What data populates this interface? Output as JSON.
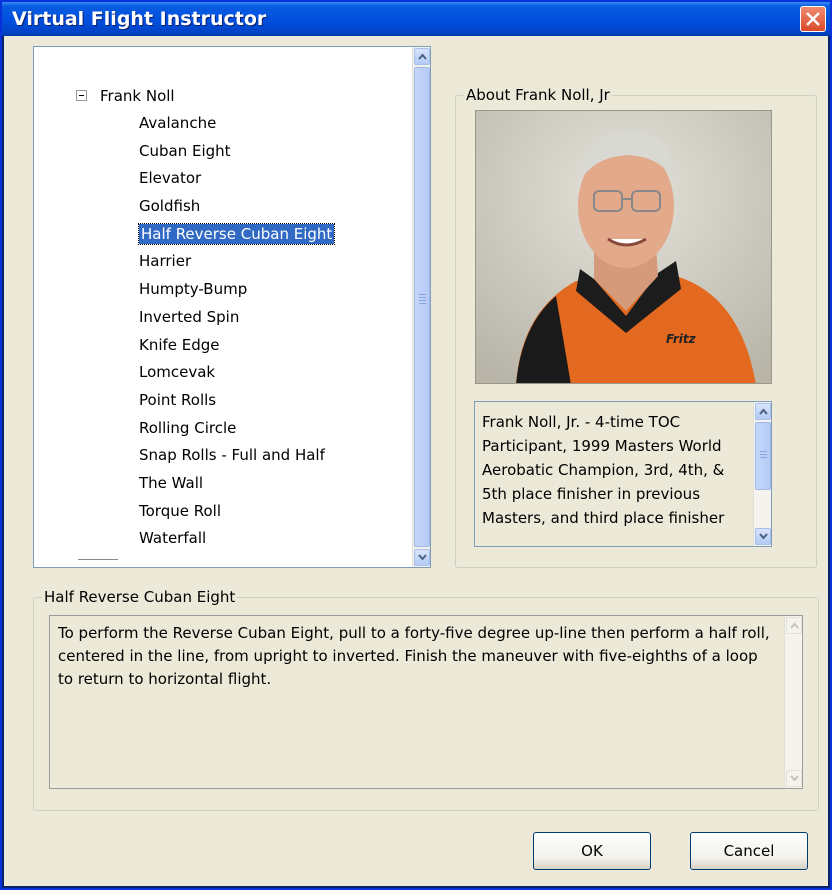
{
  "window": {
    "title": "Virtual Flight Instructor"
  },
  "tree": {
    "node_label": "Frank Noll",
    "items": [
      "Avalanche",
      "Cuban Eight",
      "Elevator",
      "Goldfish",
      "Half Reverse Cuban Eight",
      "Harrier",
      "Humpty-Bump",
      "Inverted Spin",
      "Knife Edge",
      "Lomcevak",
      "Point Rolls",
      "Rolling Circle",
      "Snap Rolls - Full and Half",
      "The Wall",
      "Torque Roll",
      "Waterfall"
    ],
    "selected_index": 4
  },
  "about": {
    "legend": "About Frank Noll, Jr",
    "bio": "Frank Noll, Jr. - 4-time TOC Participant, 1999 Masters World Aerobatic Champion, 3rd, 4th, & 5th place finisher in previous Masters, and third place finisher",
    "shirt_text": "Fritz"
  },
  "maneuver": {
    "legend": "Half Reverse Cuban Eight",
    "description": "To perform the Reverse Cuban Eight, pull to a forty-five degree up-line then perform a half roll, centered in the line, from upright to inverted. Finish the maneuver with five-eighths of a loop to return to horizontal flight."
  },
  "buttons": {
    "ok": "OK",
    "cancel": "Cancel"
  },
  "colors": {
    "titlebar": "#0054e3",
    "selection": "#316ac5",
    "dialog_bg": "#ece9d8",
    "close": "#e0573a"
  }
}
